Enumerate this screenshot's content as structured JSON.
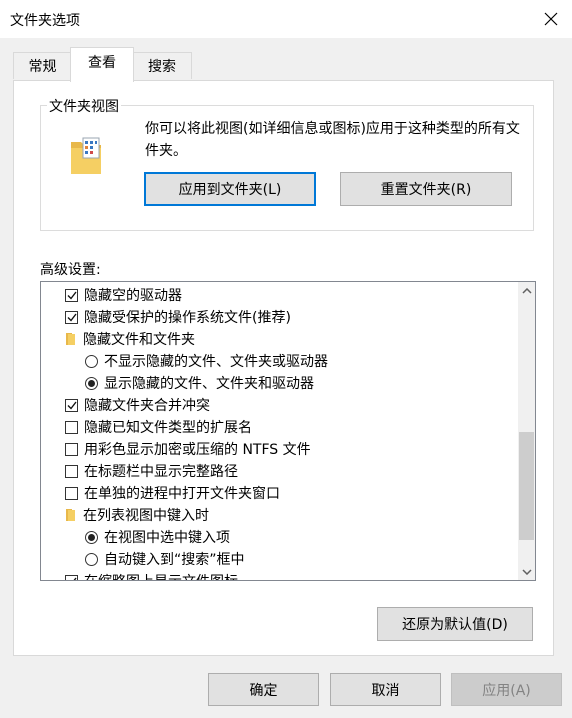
{
  "window": {
    "title": "文件夹选项"
  },
  "tabs": [
    {
      "label": "常规"
    },
    {
      "label": "查看"
    },
    {
      "label": "搜索"
    }
  ],
  "folder_views": {
    "group_label": "文件夹视图",
    "description": "你可以将此视图(如详细信息或图标)应用于这种类型的所有文件夹。",
    "apply_button": "应用到文件夹(L)",
    "reset_button": "重置文件夹(R)"
  },
  "advanced": {
    "label": "高级设置:",
    "items": [
      {
        "kind": "checkbox",
        "checked": true,
        "label": "隐藏空的驱动器"
      },
      {
        "kind": "checkbox",
        "checked": true,
        "label": "隐藏受保护的操作系统文件(推荐)"
      },
      {
        "kind": "folder",
        "label": "隐藏文件和文件夹"
      },
      {
        "kind": "radio",
        "checked": false,
        "label": "不显示隐藏的文件、文件夹或驱动器"
      },
      {
        "kind": "radio",
        "checked": true,
        "label": "显示隐藏的文件、文件夹和驱动器"
      },
      {
        "kind": "checkbox",
        "checked": true,
        "label": "隐藏文件夹合并冲突"
      },
      {
        "kind": "checkbox",
        "checked": false,
        "label": "隐藏已知文件类型的扩展名"
      },
      {
        "kind": "checkbox",
        "checked": false,
        "label": "用彩色显示加密或压缩的 NTFS 文件"
      },
      {
        "kind": "checkbox",
        "checked": false,
        "label": "在标题栏中显示完整路径"
      },
      {
        "kind": "checkbox",
        "checked": false,
        "label": "在单独的进程中打开文件夹窗口"
      },
      {
        "kind": "folder",
        "label": "在列表视图中键入时"
      },
      {
        "kind": "radio",
        "checked": true,
        "label": "在视图中选中键入项"
      },
      {
        "kind": "radio",
        "checked": false,
        "label": "自动键入到“搜索”框中"
      },
      {
        "kind": "checkbox",
        "checked": true,
        "label": "在缩略图上显示文件图标"
      }
    ],
    "scroll_fraction": 0.85
  },
  "restore_defaults_button": "还原为默认值(D)",
  "footer": {
    "ok": "确定",
    "cancel": "取消",
    "apply": "应用(A)"
  },
  "colors": {
    "accent": "#0078d7",
    "folder": "#f5cf63"
  }
}
